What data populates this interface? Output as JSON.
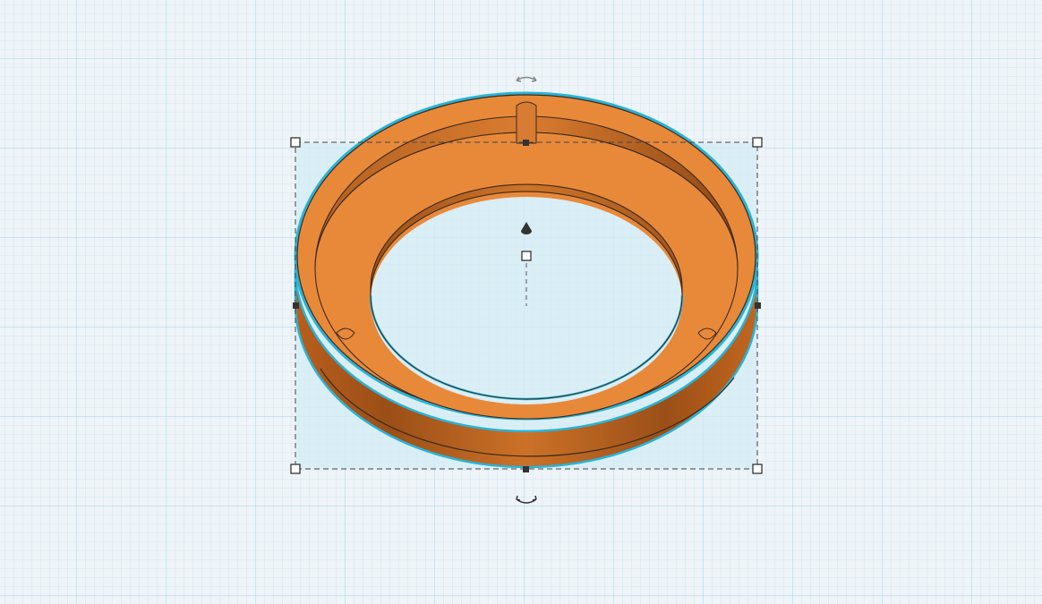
{
  "workplane": {
    "background": "#eef4f8",
    "grid_minor_color": "#cfe0ea",
    "grid_major_color": "#9fcbe0"
  },
  "shape": {
    "kind": "ring-with-notches",
    "selected": true,
    "top_color": "#e8893a",
    "side_color": "#c96b22",
    "side_dark_color": "#a45518",
    "outline_color": "#3a2a1c",
    "selection_outline_color": "#2ab3d6",
    "selection_fill_color": "#cfeaf5"
  },
  "handles": {
    "corner_names": [
      "top-left",
      "top-right",
      "bottom-left",
      "bottom-right"
    ],
    "edge_names": [
      "top",
      "bottom",
      "left",
      "right"
    ],
    "color": "#333333"
  },
  "controls": {
    "rotate_icon": "rotate-arrow-icon",
    "lift_icon": "cone-lift-icon",
    "height_icon": "height-handle-icon"
  }
}
